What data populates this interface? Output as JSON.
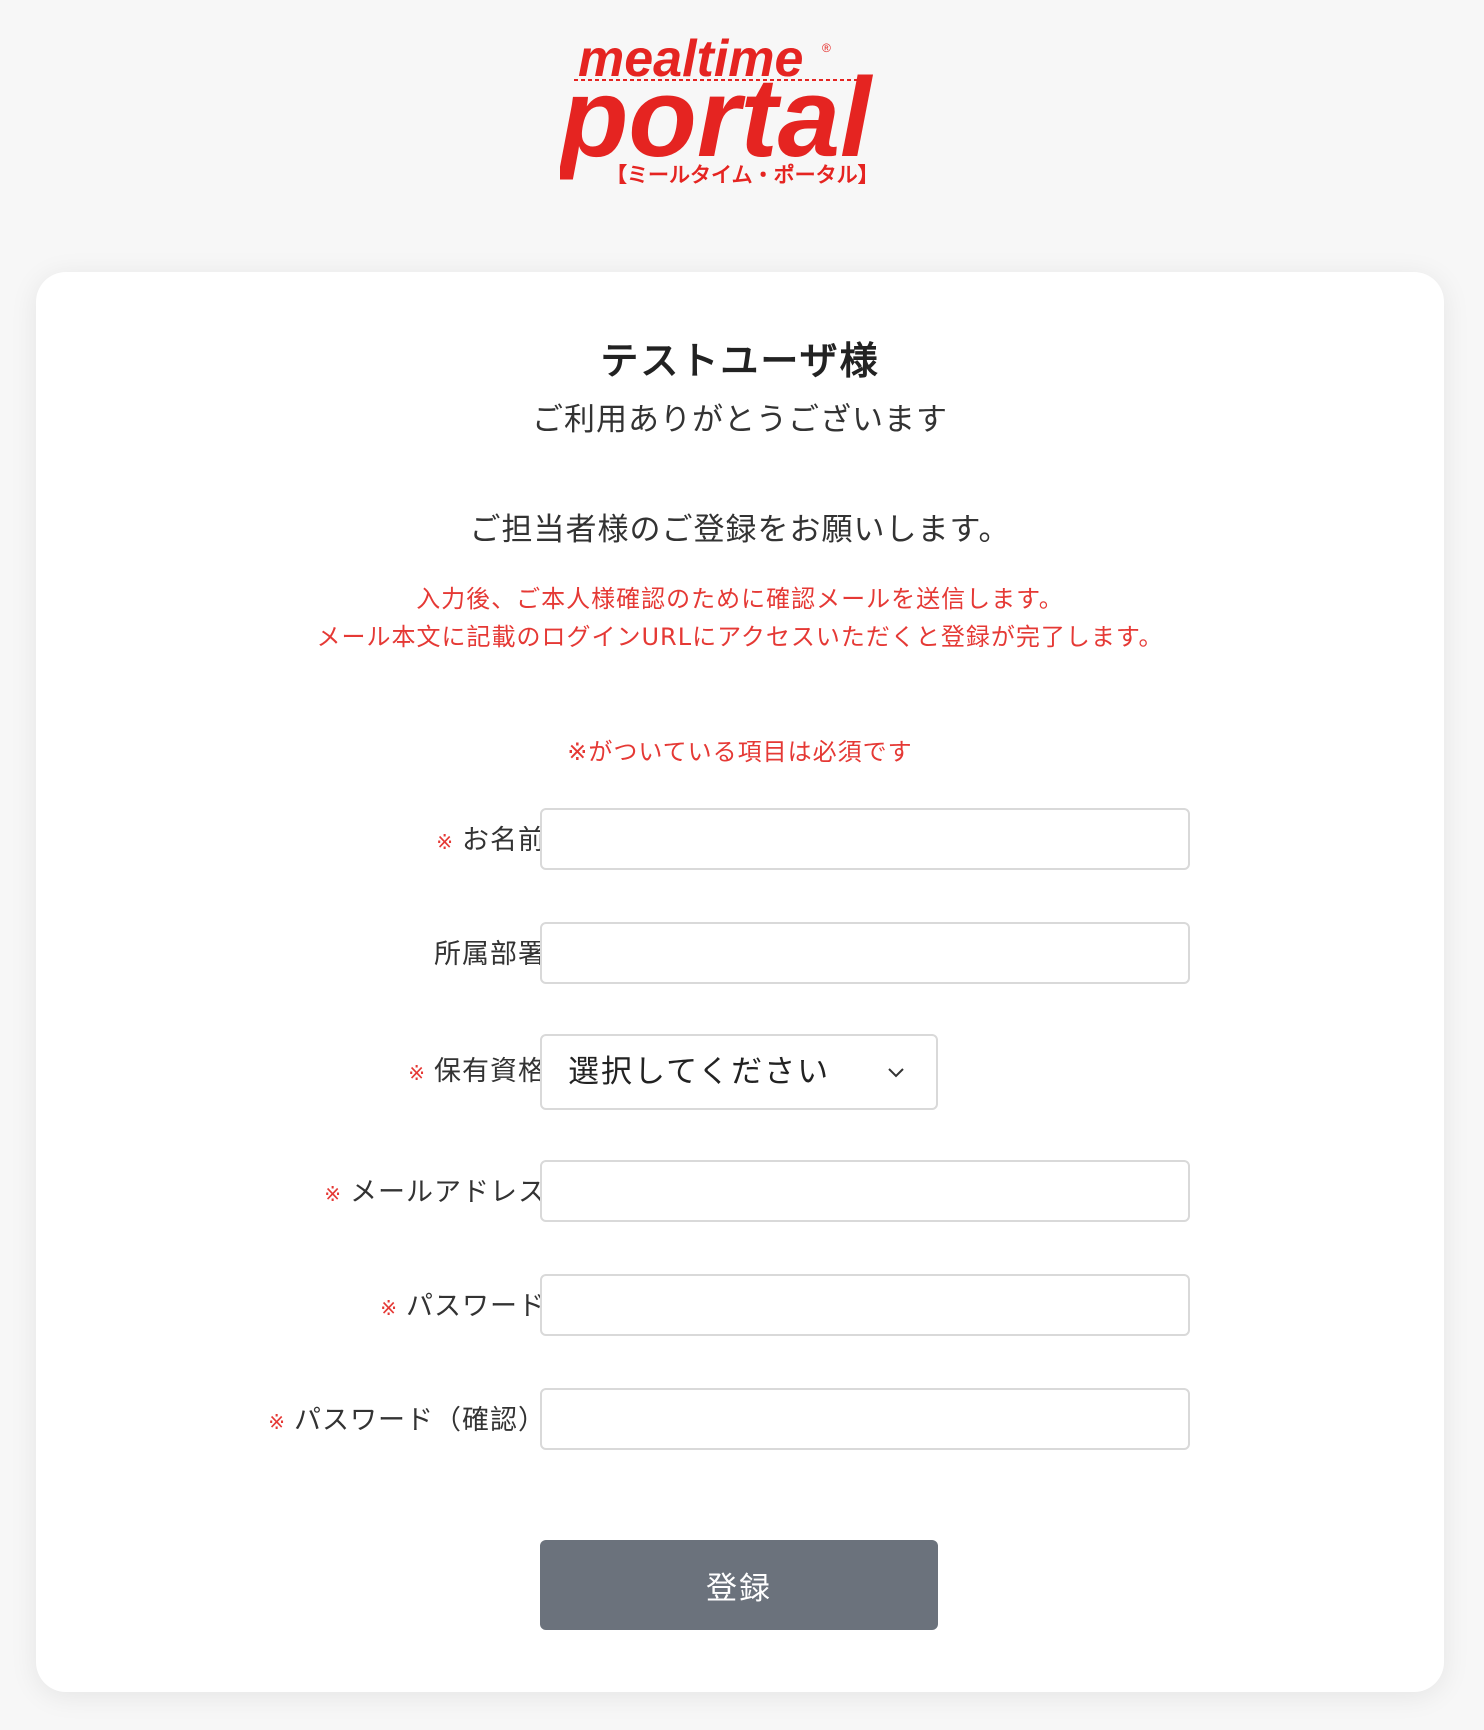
{
  "logo": {
    "line1": "mealtime",
    "registered": "®",
    "line2": "portal",
    "subtitle": "【ミールタイム・ポータル】",
    "color": "#e52421"
  },
  "header": {
    "user_name": "テストユーザ様",
    "thanks": "ご利用ありがとうございます"
  },
  "intro": {
    "request": "ご担当者様のご登録をお願いします。",
    "notice_line1": "入力後、ご本人様確認のために確認メールを送信します。",
    "notice_line2": "メール本文に記載のログインURLにアクセスいただくと登録が完了します。",
    "required_note": "※がついている項目は必須です"
  },
  "form": {
    "required_mark": "※",
    "name": {
      "label": "お名前",
      "value": "",
      "required": true
    },
    "department": {
      "label": "所属部署",
      "value": "",
      "required": false
    },
    "qualification": {
      "label": "保有資格",
      "selected": "選択してください",
      "required": true,
      "icon": "chevron-down-icon"
    },
    "email": {
      "label": "メールアドレス",
      "value": "",
      "required": true
    },
    "password": {
      "label": "パスワード",
      "value": "",
      "required": true
    },
    "password_confirm": {
      "label": "パスワード（確認）",
      "value": "",
      "required": true
    },
    "submit_label": "登録"
  },
  "colors": {
    "accent_red": "#e53935",
    "button": "#6b727c",
    "background": "#f7f7f7"
  }
}
